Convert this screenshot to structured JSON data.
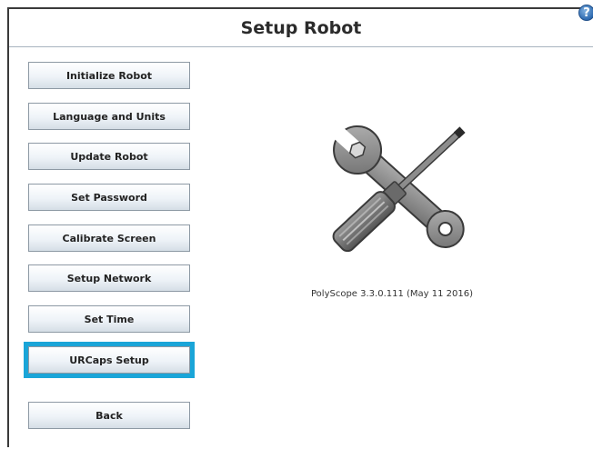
{
  "header": {
    "title": "Setup Robot",
    "help_label": "?"
  },
  "menu": {
    "items": [
      {
        "label": "Initialize Robot",
        "selected": false
      },
      {
        "label": "Language and Units",
        "selected": false
      },
      {
        "label": "Update Robot",
        "selected": false
      },
      {
        "label": "Set Password",
        "selected": false
      },
      {
        "label": "Calibrate Screen",
        "selected": false
      },
      {
        "label": "Setup Network",
        "selected": false
      },
      {
        "label": "Set Time",
        "selected": false
      },
      {
        "label": "URCaps Setup",
        "selected": true
      }
    ],
    "back_label": "Back"
  },
  "main": {
    "illustration": "wrench-screwdriver-icon",
    "version_text": "PolyScope 3.3.0.111 (May 11 2016)"
  },
  "colors": {
    "selection": "#1aa5d8",
    "divider": "#a8b4bf",
    "button_border": "#8d99a4"
  }
}
